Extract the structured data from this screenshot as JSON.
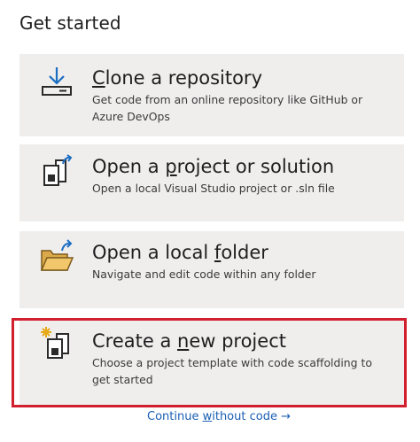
{
  "section_title": "Get started",
  "cards": {
    "clone": {
      "title_pre": "",
      "title_key": "C",
      "title_post": "lone a repository",
      "desc": "Get code from an online repository like GitHub or Azure DevOps",
      "icon": "download-to-drive-icon"
    },
    "open_project": {
      "title_pre": "Open a ",
      "title_key": "p",
      "title_post": "roject or solution",
      "desc": "Open a local Visual Studio project or .sln file",
      "icon": "open-project-icon"
    },
    "open_folder": {
      "title_pre": "Open a local ",
      "title_key": "f",
      "title_post": "older",
      "desc": "Navigate and edit code within any folder",
      "icon": "open-folder-icon"
    },
    "new_project": {
      "title_pre": "Create a ",
      "title_key": "n",
      "title_post": "ew project",
      "desc": "Choose a project template with code scaffolding to get started",
      "icon": "new-project-icon"
    }
  },
  "continue": {
    "pre": "Continue ",
    "key": "w",
    "post": "ithout code",
    "arrow": "→"
  },
  "colors": {
    "card_bg": "#f0eded",
    "highlight": "#d21f2e",
    "link": "#1a5fb4",
    "accent_blue": "#1b6ec2",
    "folder": "#dba94a",
    "spark": "#e6a817"
  }
}
